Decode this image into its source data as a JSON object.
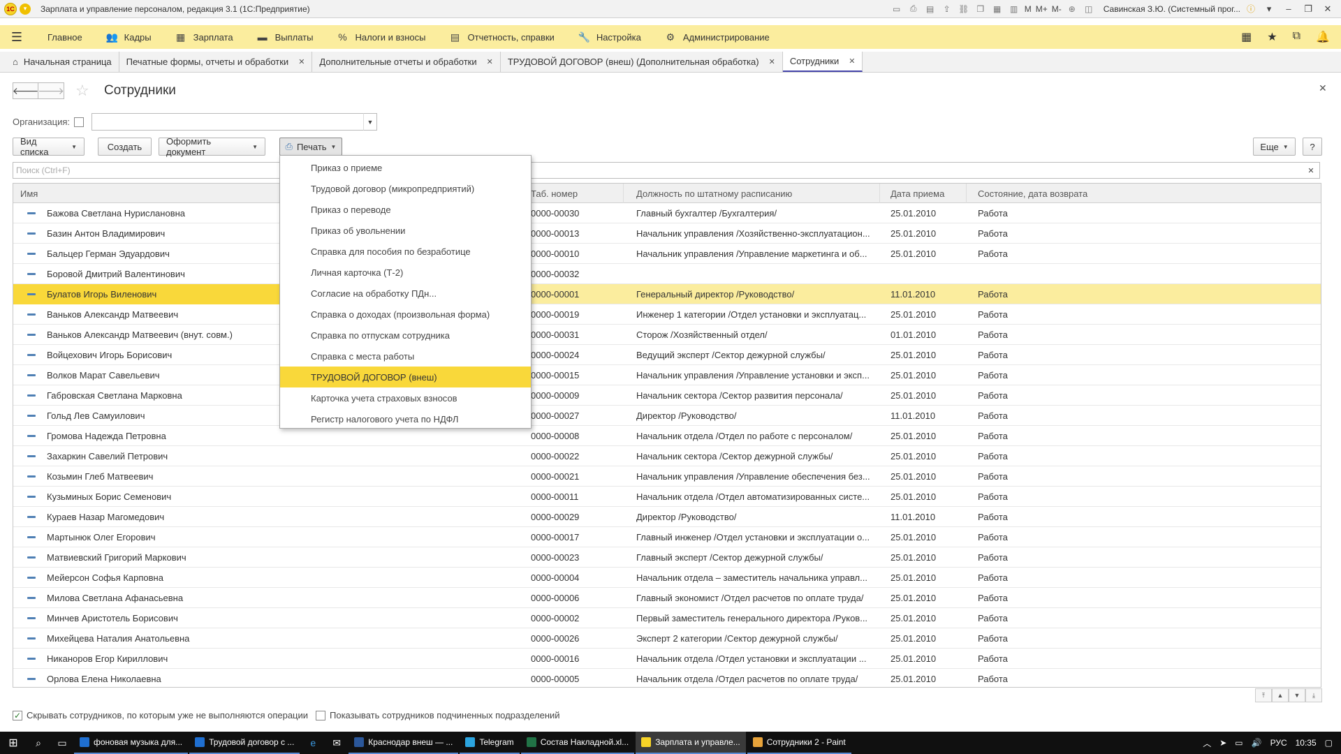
{
  "window": {
    "title": "Зарплата и управление персоналом, редакция 3.1  (1С:Предприятие)",
    "user": "Савинская З.Ю. (Системный прог...",
    "toolbar_texts": [
      "M",
      "M+",
      "M-"
    ]
  },
  "main_menu": [
    {
      "icon": "list-icon",
      "label": "Главное"
    },
    {
      "icon": "people-icon",
      "label": "Кадры"
    },
    {
      "icon": "calculator-icon",
      "label": "Зарплата"
    },
    {
      "icon": "wallet-icon",
      "label": "Выплаты"
    },
    {
      "icon": "percent-icon",
      "label": "Налоги и взносы"
    },
    {
      "icon": "report-icon",
      "label": "Отчетность, справки"
    },
    {
      "icon": "wrench-icon",
      "label": "Настройка"
    },
    {
      "icon": "gear-icon",
      "label": "Администрирование"
    }
  ],
  "tabs": [
    {
      "label": "Начальная страница",
      "closable": false
    },
    {
      "label": "Печатные формы, отчеты и обработки",
      "closable": true
    },
    {
      "label": "Дополнительные отчеты и обработки",
      "closable": true
    },
    {
      "label": "ТРУДОВОЙ ДОГОВОР (внеш) (Дополнительная обработка)",
      "closable": true
    },
    {
      "label": "Сотрудники",
      "closable": true,
      "active": true
    }
  ],
  "page": {
    "title": "Сотрудники",
    "org_label": "Организация:",
    "buttons": {
      "view_list": "Вид списка",
      "create": "Создать",
      "make_doc": "Оформить документ",
      "print": "Печать",
      "more": "Еще",
      "help": "?"
    },
    "search_placeholder": "Поиск (Ctrl+F)"
  },
  "table": {
    "columns": [
      "Имя",
      "Таб. номер",
      "Должность по штатному расписанию",
      "Дата приема",
      "Состояние, дата возврата"
    ],
    "rows": [
      {
        "name": "Бажова Светлана Нурислановна",
        "num": "0000-00030",
        "pos": "Главный бухгалтер /Бухгалтерия/",
        "date": "25.01.2010",
        "state": "Работа"
      },
      {
        "name": "Базин Антон Владимирович",
        "num": "0000-00013",
        "pos": "Начальник управления /Хозяйственно-эксплуатацион...",
        "date": "25.01.2010",
        "state": "Работа"
      },
      {
        "name": "Бальцер Герман Эдуардович",
        "num": "0000-00010",
        "pos": "Начальник управления /Управление маркетинга и об...",
        "date": "25.01.2010",
        "state": "Работа"
      },
      {
        "name": "Боровой Дмитрий Валентинович",
        "num": "0000-00032",
        "pos": "",
        "date": "",
        "state": ""
      },
      {
        "name": "Булатов Игорь Виленович",
        "num": "0000-00001",
        "pos": "Генеральный директор /Руководство/",
        "date": "11.01.2010",
        "state": "Работа",
        "selected": true
      },
      {
        "name": "Ваньков Александр Матвеевич",
        "num": "0000-00019",
        "pos": "Инженер 1 категории /Отдел установки и эксплуатац...",
        "date": "25.01.2010",
        "state": "Работа"
      },
      {
        "name": "Ваньков Александр Матвеевич (внут. совм.)",
        "num": "0000-00031",
        "pos": "Сторож /Хозяйственный отдел/",
        "date": "01.01.2010",
        "state": "Работа"
      },
      {
        "name": "Войцехович Игорь Борисович",
        "num": "0000-00024",
        "pos": "Ведущий эксперт /Сектор дежурной службы/",
        "date": "25.01.2010",
        "state": "Работа"
      },
      {
        "name": "Волков Марат Савельевич",
        "num": "0000-00015",
        "pos": "Начальник управления /Управление установки и эксп...",
        "date": "25.01.2010",
        "state": "Работа"
      },
      {
        "name": "Габровская Светлана Марковна",
        "num": "0000-00009",
        "pos": "Начальник сектора /Сектор развития персонала/",
        "date": "25.01.2010",
        "state": "Работа"
      },
      {
        "name": "Гольд Лев Самуилович",
        "num": "0000-00027",
        "pos": "Директор /Руководство/",
        "date": "11.01.2010",
        "state": "Работа"
      },
      {
        "name": "Громова Надежда Петровна",
        "num": "0000-00008",
        "pos": "Начальник отдела /Отдел по работе с персоналом/",
        "date": "25.01.2010",
        "state": "Работа"
      },
      {
        "name": "Захаркин Савелий Петрович",
        "num": "0000-00022",
        "pos": "Начальник сектора /Сектор дежурной службы/",
        "date": "25.01.2010",
        "state": "Работа"
      },
      {
        "name": "Козьмин Глеб Матвеевич",
        "num": "0000-00021",
        "pos": "Начальник управления /Управление обеспечения без...",
        "date": "25.01.2010",
        "state": "Работа"
      },
      {
        "name": "Кузьминых Борис Семенович",
        "num": "0000-00011",
        "pos": "Начальник отдела /Отдел автоматизированных систе...",
        "date": "25.01.2010",
        "state": "Работа"
      },
      {
        "name": "Кураев Назар Магомедович",
        "num": "0000-00029",
        "pos": "Директор /Руководство/",
        "date": "11.01.2010",
        "state": "Работа"
      },
      {
        "name": "Мартынюк Олег Егорович",
        "num": "0000-00017",
        "pos": "Главный инженер /Отдел установки и эксплуатации о...",
        "date": "25.01.2010",
        "state": "Работа"
      },
      {
        "name": "Матвиевский Григорий Маркович",
        "num": "0000-00023",
        "pos": "Главный эксперт /Сектор дежурной службы/",
        "date": "25.01.2010",
        "state": "Работа"
      },
      {
        "name": "Мейерсон Софья Карповна",
        "num": "0000-00004",
        "pos": "Начальник отдела – заместитель начальника управл...",
        "date": "25.01.2010",
        "state": "Работа"
      },
      {
        "name": "Милова Светлана Афанасьевна",
        "num": "0000-00006",
        "pos": "Главный экономист /Отдел расчетов по оплате труда/",
        "date": "25.01.2010",
        "state": "Работа"
      },
      {
        "name": "Минчев Аристотель Борисович",
        "num": "0000-00002",
        "pos": "Первый заместитель генерального директора /Руков...",
        "date": "25.01.2010",
        "state": "Работа"
      },
      {
        "name": "Михейцева Наталия Анатольевна",
        "num": "0000-00026",
        "pos": "Эксперт 2 категории /Сектор дежурной службы/",
        "date": "25.01.2010",
        "state": "Работа"
      },
      {
        "name": "Никаноров Егор Кириллович",
        "num": "0000-00016",
        "pos": "Начальник отдела /Отдел установки и эксплуатации ...",
        "date": "25.01.2010",
        "state": "Работа"
      },
      {
        "name": "Орлова Елена Николаевна",
        "num": "0000-00005",
        "pos": "Начальник отдела /Отдел расчетов по оплате труда/",
        "date": "25.01.2010",
        "state": "Работа"
      }
    ]
  },
  "print_menu": [
    {
      "label": "Приказ о приеме"
    },
    {
      "label": "Трудовой договор (микропредприятий)"
    },
    {
      "label": "Приказ о переводе"
    },
    {
      "label": "Приказ об увольнении"
    },
    {
      "label": "Справка для пособия по безработице"
    },
    {
      "label": "Личная карточка (Т-2)"
    },
    {
      "label": "Согласие на обработку ПДн..."
    },
    {
      "label": "Справка о доходах (произвольная форма)"
    },
    {
      "label": "Справка по отпускам сотрудника"
    },
    {
      "label": "Справка с места работы"
    },
    {
      "label": "ТРУДОВОЙ ДОГОВОР (внеш)",
      "highlighted": true
    },
    {
      "label": "Карточка учета страховых взносов"
    },
    {
      "label": "Регистр налогового учета по НДФЛ"
    }
  ],
  "bottom": {
    "hide_inactive": "Скрывать сотрудников, по которым уже не выполняются операции",
    "show_sub": "Показывать сотрудников подчиненных подразделений"
  },
  "taskbar": {
    "apps": [
      {
        "label": "фоновая музыка для...",
        "color": "#1f6fd1"
      },
      {
        "label": "Трудовой договор с ...",
        "color": "#1f6fd1"
      },
      {
        "label": "Краснодар внеш — ...",
        "color": "#2b579a"
      },
      {
        "label": "Telegram",
        "color": "#2ca5e0"
      },
      {
        "label": "Состав Накладной.xl...",
        "color": "#217346"
      },
      {
        "label": "Зарплата и управле...",
        "color": "#f7d327",
        "active": true
      },
      {
        "label": "Сотрудники 2 - Paint",
        "color": "#e8a33a"
      }
    ],
    "lang": "РУС",
    "time": "10:35"
  },
  "colors": {
    "menu_bg": "#fbed9e",
    "highlight": "#f9d83a",
    "row_selected": "#fbed9e"
  }
}
